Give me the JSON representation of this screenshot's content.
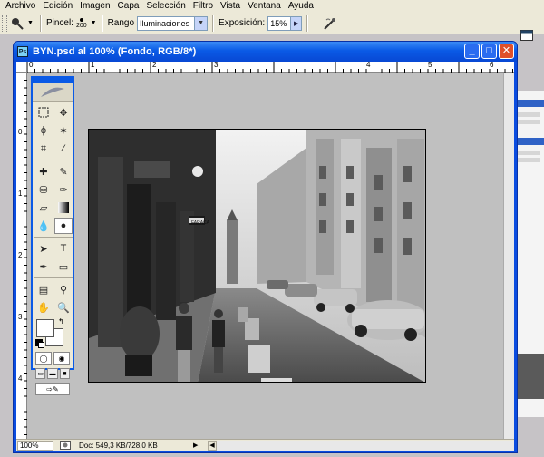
{
  "menu": [
    "Archivo",
    "Edición",
    "Imagen",
    "Capa",
    "Selección",
    "Filtro",
    "Vista",
    "Ventana",
    "Ayuda"
  ],
  "options": {
    "brush_label": "Pincel:",
    "brush_size": "200",
    "range_label": "Rango",
    "range_value": "Iluminaciones",
    "exposure_label": "Exposición:",
    "exposure_value": "15%"
  },
  "document": {
    "title": "BYN.psd al 100% (Fondo, RGB/8*)",
    "ruler_top": [
      "0",
      "1",
      "2",
      "3",
      "4",
      "5",
      "6"
    ],
    "ruler_left": [
      "0",
      "1",
      "2",
      "3",
      "4"
    ],
    "status_zoom": "100%",
    "status_doc": "Doc: 549,3 KB/728,0 KB"
  },
  "colors": {
    "title_blue": "#0a5ae6",
    "close_red": "#e0502a",
    "canvas_gray": "#c0c0c0"
  },
  "photo_signs": {
    "shop": "FARACA"
  }
}
